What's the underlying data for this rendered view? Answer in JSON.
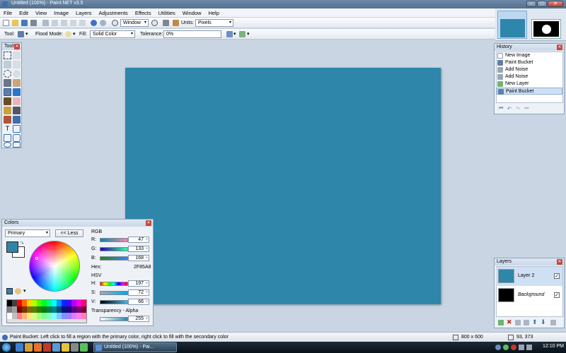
{
  "app": {
    "title": "Untitled (100%) - Paint.NET v3.5",
    "window_buttons": [
      "–",
      "□",
      "✕"
    ]
  },
  "menu": [
    "File",
    "Edit",
    "View",
    "Image",
    "Layers",
    "Adjustments",
    "Effects",
    "Utilities",
    "Window",
    "Help"
  ],
  "toolbar": {
    "zoom_select": "Window",
    "units_label": "Units:",
    "units_value": "Pixels",
    "tool_label": "Tool:",
    "flood_mode_label": "Flood Mode:",
    "fill_label": "Fill:",
    "fill_value": "Solid Color",
    "tolerance_label": "Tolerance:",
    "tolerance_value": "0%"
  },
  "tools_panel": {
    "title": "Tools"
  },
  "history": {
    "title": "History",
    "items": [
      "New Image",
      "Paint Bucket",
      "Add Noise",
      "Add Noise",
      "New Layer",
      "Paint Bucket"
    ],
    "selected_index": 5
  },
  "colors": {
    "title": "Colors",
    "mode": "Primary",
    "less_button": "<< Less",
    "rgb_label": "RGB",
    "r_label": "R:",
    "r": "47",
    "g_label": "G:",
    "g": "133",
    "b_label": "B:",
    "b": "168",
    "hex_label": "Hex:",
    "hex": "2F85A8",
    "hsv_label": "HSV",
    "h_label": "H:",
    "h": "197",
    "s_label": "S:",
    "s": "72",
    "v_label": "V:",
    "v": "66",
    "transparency_label": "Transparency - Alpha",
    "alpha": "255",
    "primary_color": "#2f85a8",
    "secondary_color": "#ffffff"
  },
  "canvas": {
    "color": "#2e86ab"
  },
  "layers": {
    "title": "Layers",
    "items": [
      {
        "name": "Layer 2",
        "color": "#2e86ab",
        "checked": "✓"
      },
      {
        "name": "Background",
        "color": "#000000",
        "checked": "✓"
      }
    ]
  },
  "status": {
    "message": "Paint Bucket: Left click to fill a region with the primary color, right click to fill with the secondary color",
    "image_size": "800 x 600",
    "cursor_pos": "93, 373"
  },
  "taskbar": {
    "task_label": "Untitled (100%) - Pai...",
    "clock": "12:10 PM"
  }
}
